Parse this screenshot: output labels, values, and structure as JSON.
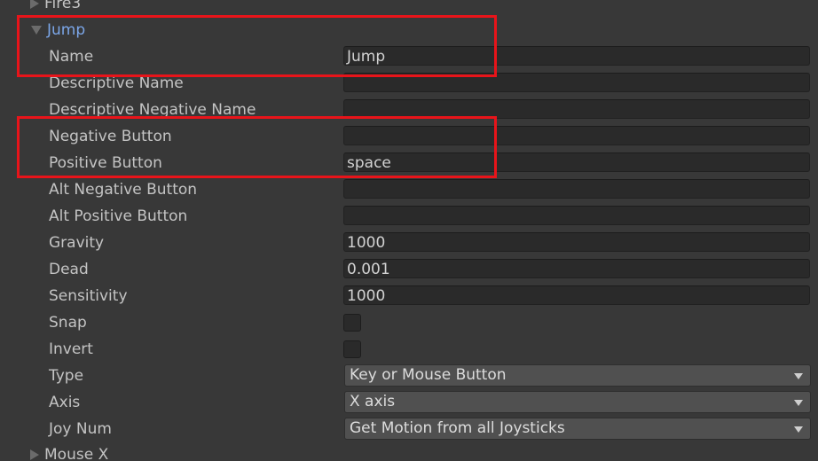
{
  "items": {
    "fire3": "Fire3",
    "jump": "Jump",
    "mouse_x": "Mouse X"
  },
  "jump": {
    "name": {
      "label": "Name",
      "value": "Jump"
    },
    "descriptive_name": {
      "label": "Descriptive Name",
      "value": ""
    },
    "descriptive_negative_name": {
      "label": "Descriptive Negative Name",
      "value": ""
    },
    "negative_button": {
      "label": "Negative Button",
      "value": ""
    },
    "positive_button": {
      "label": "Positive Button",
      "value": "space"
    },
    "alt_negative_button": {
      "label": "Alt Negative Button",
      "value": ""
    },
    "alt_positive_button": {
      "label": "Alt Positive Button",
      "value": ""
    },
    "gravity": {
      "label": "Gravity",
      "value": "1000"
    },
    "dead": {
      "label": "Dead",
      "value": "0.001"
    },
    "sensitivity": {
      "label": "Sensitivity",
      "value": "1000"
    },
    "snap": {
      "label": "Snap",
      "checked": false
    },
    "invert": {
      "label": "Invert",
      "checked": false
    },
    "type": {
      "label": "Type",
      "value": "Key or Mouse Button"
    },
    "axis": {
      "label": "Axis",
      "value": "X axis"
    },
    "joy_num": {
      "label": "Joy Num",
      "value": "Get Motion from all Joysticks"
    }
  },
  "colors": {
    "background": "#383838",
    "field": "#2a2a2a",
    "dropdown": "#505050",
    "active_label": "#7ba6e8",
    "highlight": "#e8141a"
  }
}
